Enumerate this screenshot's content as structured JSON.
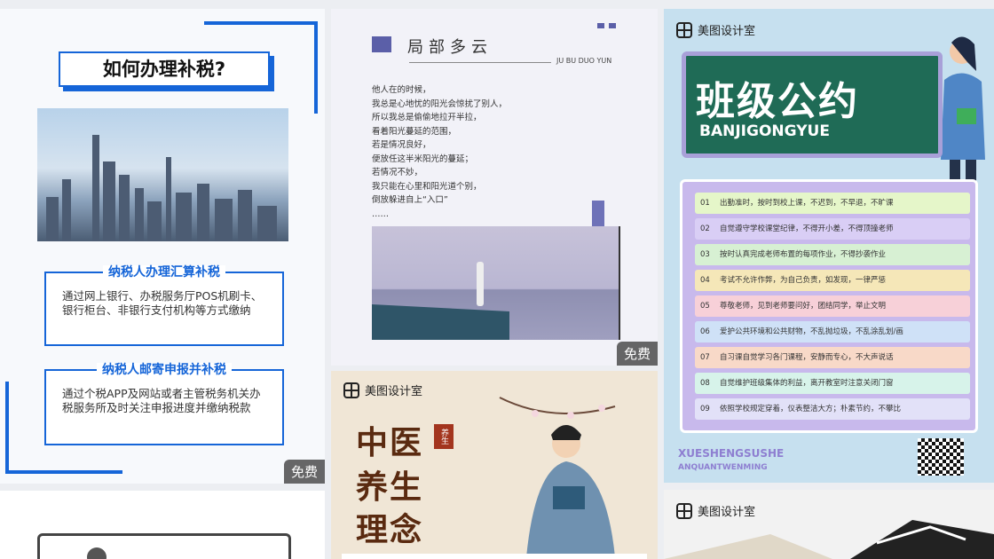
{
  "card1": {
    "title": "如何办理补税?",
    "section1": {
      "heading": "纳税人办理汇算补税",
      "body": "通过网上银行、办税服务厅POS机刷卡、银行柜台、非银行支付机构等方式缴纳"
    },
    "section2": {
      "heading": "纳税人邮寄申报并补税",
      "body": "通过个税APP及网站或者主管税务机关办税服务所及时关注申报进度并缴纳税款"
    },
    "badge": "免费"
  },
  "card2": {
    "title": "局部多云",
    "subtitle": "JU BU DUO YUN",
    "poem": [
      "他人在的时候，",
      "我总是心地忧的阳光会惊扰了别人，",
      "所以我总是偷偷地拉开半拉，",
      "看着阳光蔓延的范围，",
      "若是情况良好，",
      "便放任这半米阳光的蔓延；",
      "若情况不妙，",
      "我只能在心里和阳光道个别，",
      "倒放躲进自上“入口”",
      "……"
    ],
    "badge": "免费"
  },
  "card3": {
    "brand": "美图设计室",
    "title": "班级公约",
    "title_pinyin": "BANJIGONGYUE",
    "rules": [
      {
        "n": "01",
        "text": "出勤准时，按时到校上课，不迟到，不早退，不旷课",
        "color": "#e5f6c9"
      },
      {
        "n": "02",
        "text": "自觉遵守学校课堂纪律，不得开小差，不得顶撞老师",
        "color": "#d9cef5"
      },
      {
        "n": "03",
        "text": "按时认真完成老师布置的每项作业，不得抄袭作业",
        "color": "#d7f0d3"
      },
      {
        "n": "04",
        "text": "考试不允许作弊，为自己负责，如发现，一律严惩",
        "color": "#f5e7b8"
      },
      {
        "n": "05",
        "text": "尊敬老师，见到老师要问好，团结同学，举止文明",
        "color": "#f7d0d8"
      },
      {
        "n": "06",
        "text": "爱护公共环境和公共财物，不乱抛垃圾，不乱涂乱划/画",
        "color": "#cfe1f7"
      },
      {
        "n": "07",
        "text": "自习课自觉学习各门课程，安静而专心，不大声说话",
        "color": "#f8d9c8"
      },
      {
        "n": "08",
        "text": "自觉维护班级集体的利益，离开教室时注意关闭门窗",
        "color": "#d7f3ea"
      },
      {
        "n": "09",
        "text": "依照学校规定穿着，仪表整洁大方；朴素节约，不攀比",
        "color": "#e2e1f8"
      }
    ],
    "footer1": "XUESHENGSUSHE",
    "footer2": "ANQUANTWENMING"
  },
  "card4": {
    "brand": "美图设计室",
    "line1": "中医",
    "line2": "养生",
    "line3": "理念",
    "stamp": "养生"
  },
  "card6": {
    "brand": "美图设计室"
  }
}
